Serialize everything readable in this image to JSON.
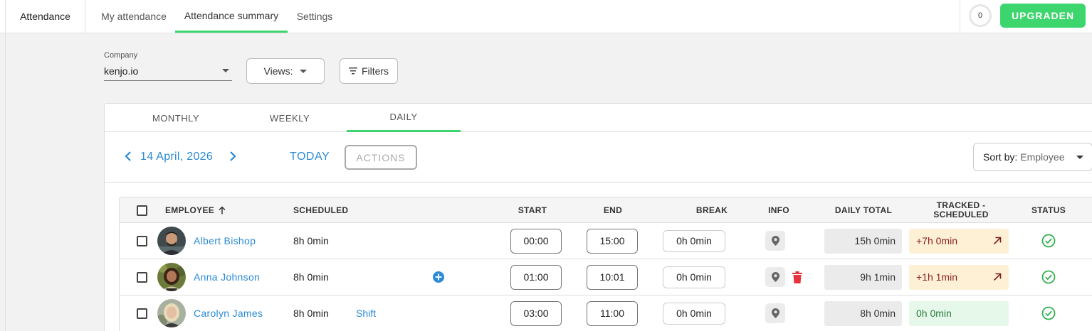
{
  "topbar": {
    "app_title": "Attendance",
    "tabs": [
      {
        "label": "My attendance"
      },
      {
        "label": "Attendance summary"
      },
      {
        "label": "Settings"
      }
    ],
    "counter": "0",
    "upgrade_label": "UPGRADEN"
  },
  "filters": {
    "company_label": "Company",
    "company_value": "kenjo.io",
    "views_label": "Views:",
    "filters_label": "Filters"
  },
  "panel": {
    "tabs": [
      {
        "label": "MONTHLY"
      },
      {
        "label": "WEEKLY"
      },
      {
        "label": "DAILY"
      }
    ],
    "active_tab": "DAILY",
    "date": "14 April, 2026",
    "today_label": "TODAY",
    "actions_label": "ACTIONS",
    "sort_label": "Sort by:",
    "sort_value": "Employee"
  },
  "table": {
    "headers": {
      "employee": "EMPLOYEE",
      "scheduled": "SCHEDULED",
      "start": "START",
      "end": "END",
      "break": "BREAK",
      "info": "INFO",
      "daily_total": "DAILY TOTAL",
      "tracked_line1": "TRACKED -",
      "tracked_line2": "SCHEDULED",
      "status": "STATUS"
    },
    "rows": [
      {
        "name": "Albert Bishop",
        "scheduled": "8h 0min",
        "shift": "",
        "start": "00:00",
        "end": "15:00",
        "break": "0h 0min",
        "daily_total": "15h 0min",
        "tracked": "+7h 0min",
        "tracked_state": "over"
      },
      {
        "name": "Anna Johnson",
        "scheduled": "8h 0min",
        "shift": "",
        "start": "01:00",
        "end": "10:01",
        "break": "0h 0min",
        "daily_total": "9h 1min",
        "tracked": "+1h 1min",
        "tracked_state": "over"
      },
      {
        "name": "Carolyn James",
        "scheduled": "8h 0min",
        "shift": "Shift",
        "start": "03:00",
        "end": "11:00",
        "break": "0h 0min",
        "daily_total": "8h 0min",
        "tracked": "0h 0min",
        "tracked_state": "ok"
      }
    ]
  },
  "colors": {
    "accent_green": "#3dd56d",
    "link_blue": "#2b8ad6",
    "delete_red": "#e8333c",
    "status_green": "#2fb04d",
    "over_bg": "#fdf0d5",
    "ok_bg": "#e6f8ea"
  }
}
